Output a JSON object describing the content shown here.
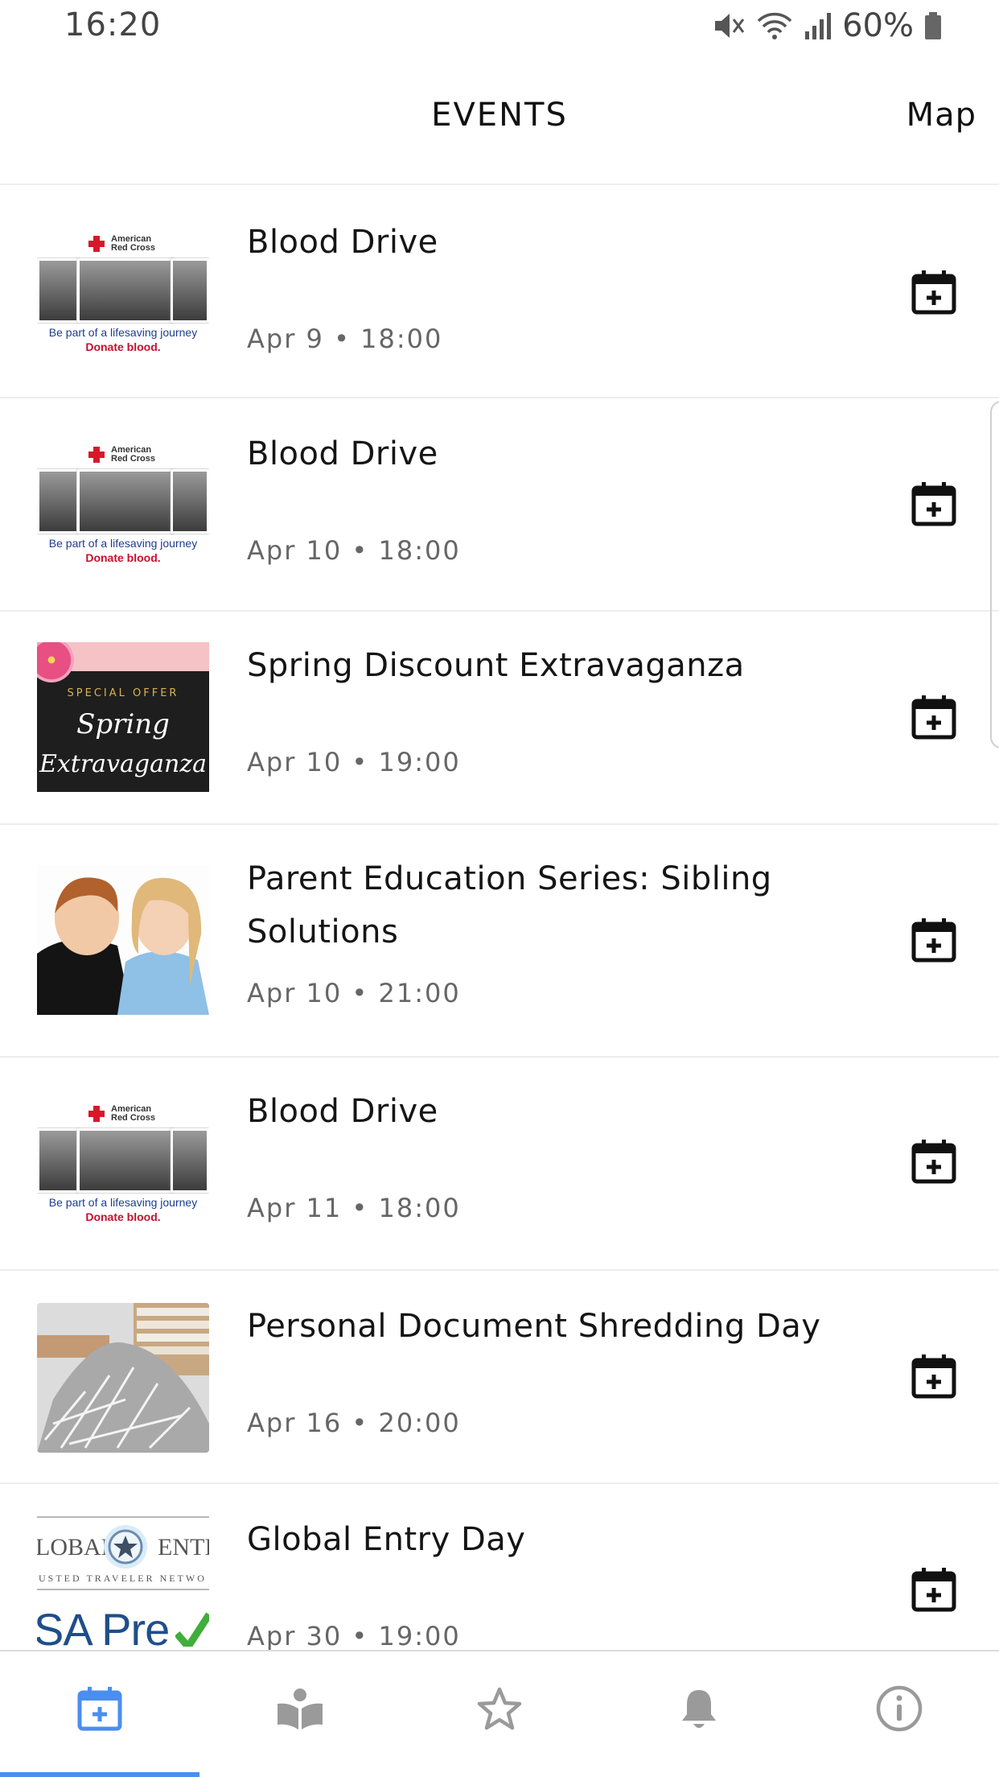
{
  "status_bar": {
    "time": "16:20",
    "battery": "60%",
    "icons": [
      "mute-icon",
      "wifi-icon",
      "signal-icon",
      "battery-icon"
    ]
  },
  "header": {
    "title": "EVENTS",
    "map_label": "Map"
  },
  "events": [
    {
      "title": "Blood Drive",
      "date": "Apr 9 • 18:00",
      "image": "red-cross"
    },
    {
      "title": "Blood Drive",
      "date": "Apr 10 • 18:00",
      "image": "red-cross"
    },
    {
      "title": "Spring Discount Extravaganza",
      "date": "Apr 10 • 19:00",
      "image": "spring"
    },
    {
      "title": "Parent Education Series: Sibling Solutions",
      "date": "Apr 10 • 21:00",
      "image": "kids"
    },
    {
      "title": "Blood Drive",
      "date": "Apr 11 • 18:00",
      "image": "red-cross"
    },
    {
      "title": "Personal Document Shredding Day",
      "date": "Apr 16 • 20:00",
      "image": "shredding"
    },
    {
      "title": "Global Entry Day",
      "date": "Apr 30 • 19:00",
      "image": "global-entry"
    }
  ],
  "thumbs": {
    "red_cross": {
      "org_line1": "American",
      "org_line2": "Red Cross",
      "tagline": "Be part of a lifesaving journey",
      "cta": "Donate blood."
    },
    "spring": {
      "offer": "SPECIAL OFFER",
      "word1": "Spring",
      "word2": "Extravaganza"
    },
    "global_entry": {
      "left": "LOBAL",
      "right": "ENTI",
      "sub": "USTED TRAVELER NETWO",
      "pre": "SA Pre"
    }
  },
  "bottom_nav": [
    {
      "icon": "calendar-add-icon",
      "active": true
    },
    {
      "icon": "book-reader-icon",
      "active": false
    },
    {
      "icon": "star-icon",
      "active": false
    },
    {
      "icon": "bell-icon",
      "active": false
    },
    {
      "icon": "info-icon",
      "active": false
    }
  ],
  "colors": {
    "accent": "#4a8ef0",
    "text": "#151515",
    "date_text": "#666666",
    "divider": "#ededed",
    "inactive_icon": "#9a9a9a"
  }
}
